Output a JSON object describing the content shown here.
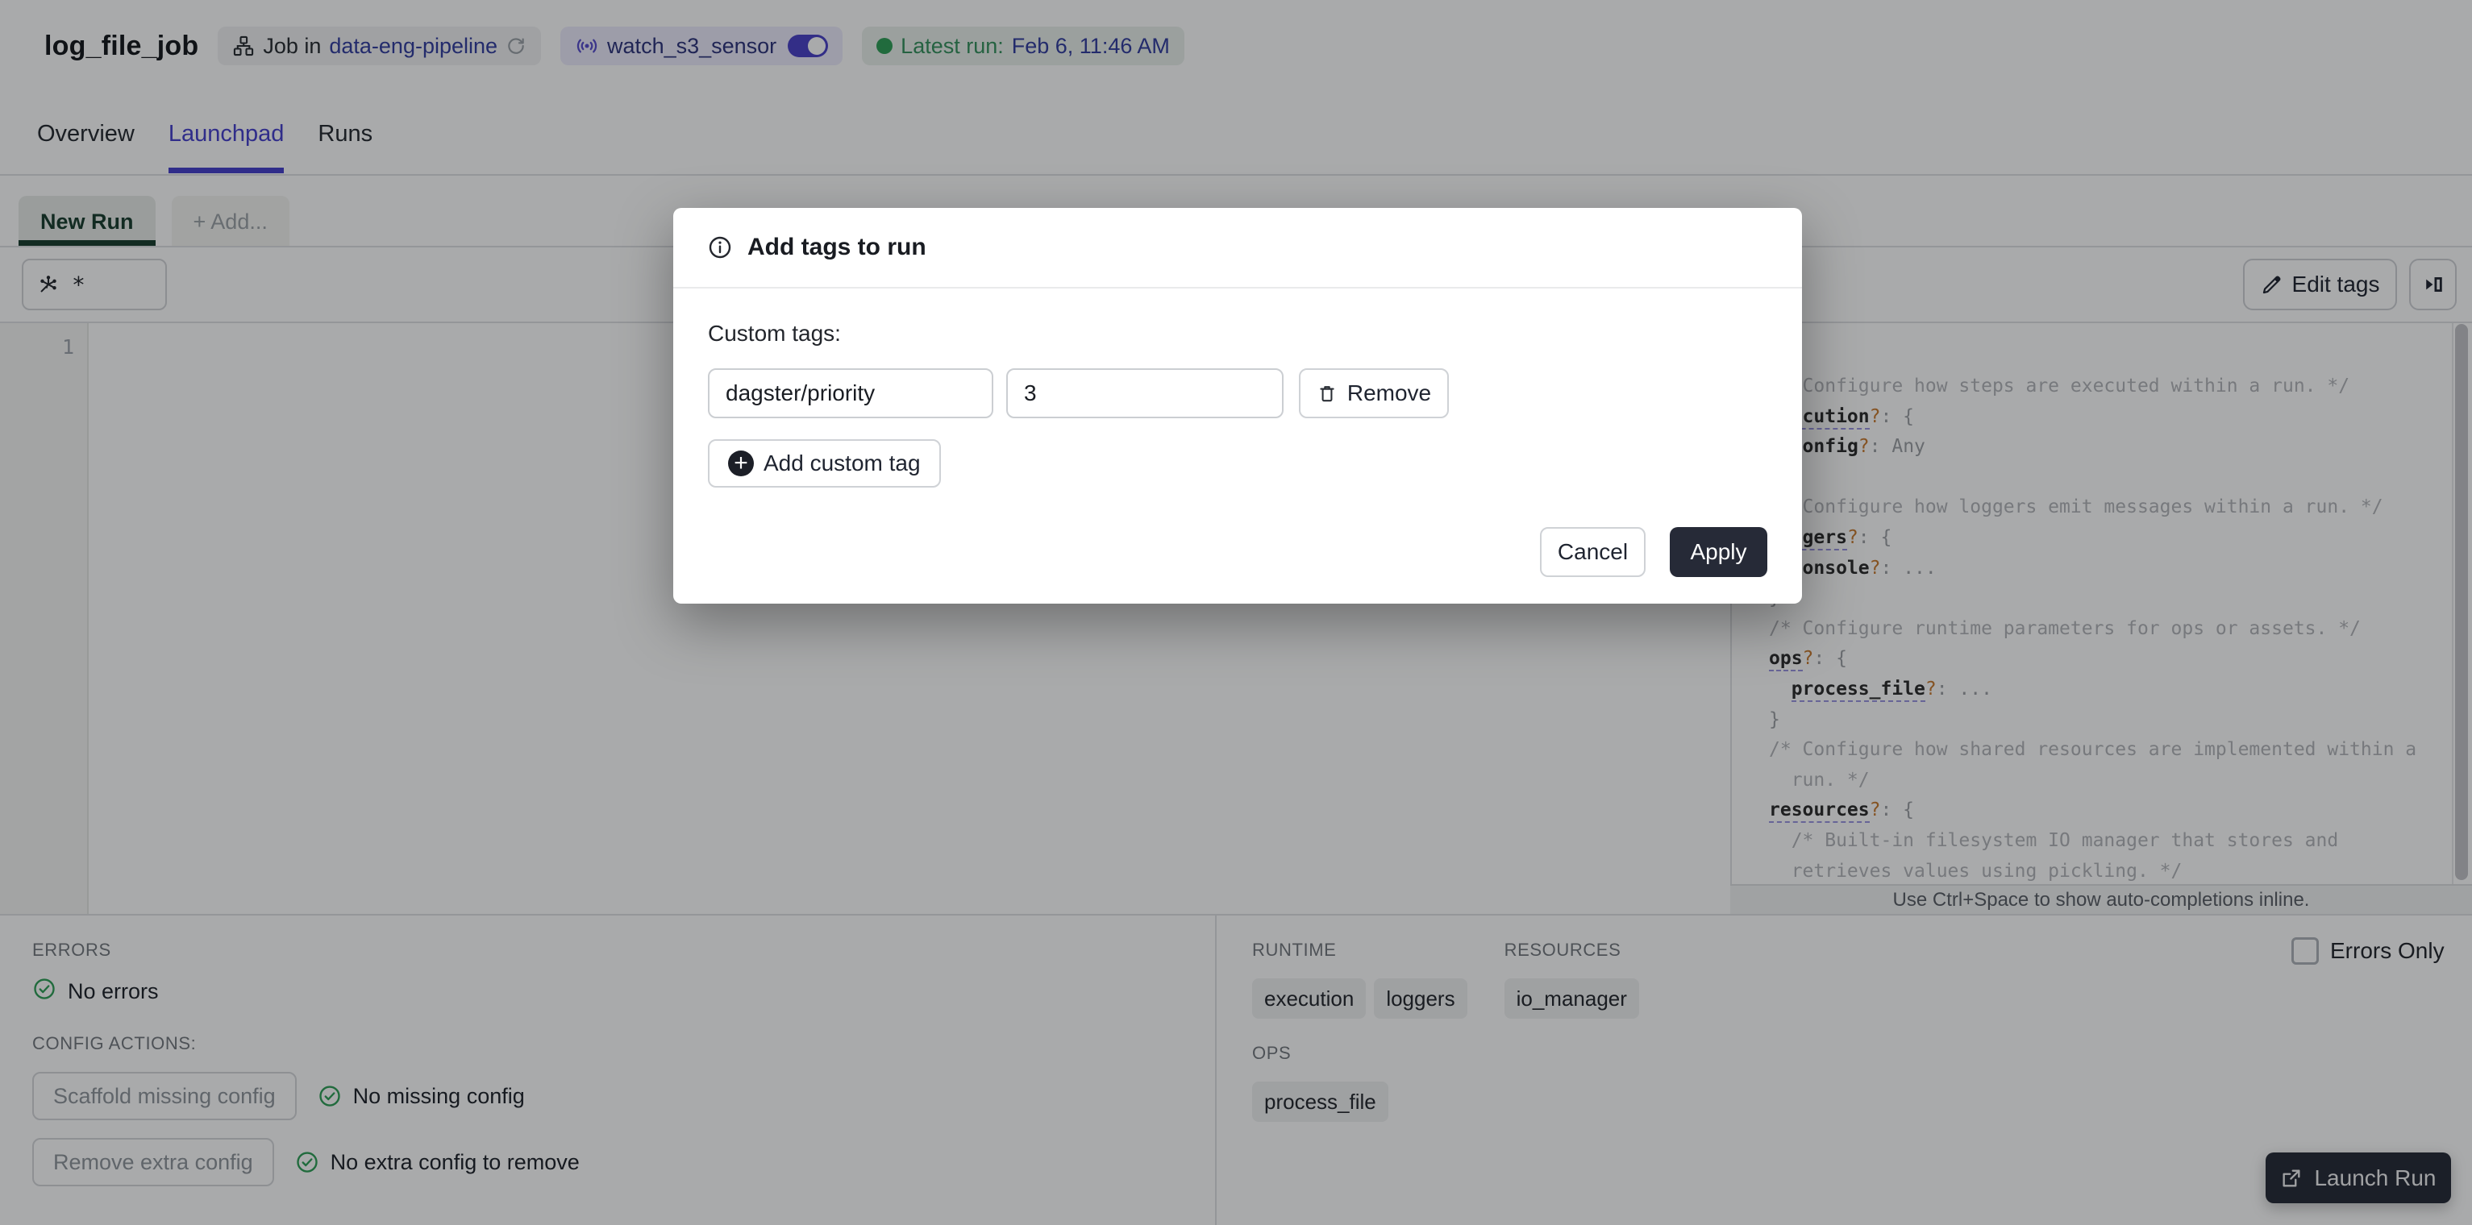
{
  "colors": {
    "accent_blurple": "#453FCC",
    "link_navy": "#323D9E",
    "sensor_badge_bg": "#EDEBFC",
    "latest_badge_bg": "#EAF0EC",
    "badge_bg": "#F1F2F3",
    "success_green": "#2E9E57",
    "primary_button_bg": "#262A37",
    "run_tab_green": "#183D2D",
    "code_key": "#2B2B2B",
    "code_comment": "#B2B4B8",
    "code_question": "#C87A2E",
    "code_punct": "#9B9EA3",
    "lint_underline": "#9A94E0"
  },
  "header": {
    "title": "log_file_job",
    "job_badge": {
      "prefix": "Job in",
      "link": "data-eng-pipeline"
    },
    "sensor_badge": {
      "label": "watch_s3_sensor",
      "toggle_on": true
    },
    "latest_run_badge": {
      "prefix": "Latest run:",
      "value": "Feb 6, 11:46 AM"
    }
  },
  "tabs": [
    {
      "label": "Overview",
      "active": false
    },
    {
      "label": "Launchpad",
      "active": true
    },
    {
      "label": "Runs",
      "active": false
    }
  ],
  "launchpad": {
    "run_tabs": [
      {
        "label": "New Run",
        "active": true
      },
      {
        "label": "+ Add...",
        "active": false
      }
    ],
    "op_selector": {
      "value": "*"
    },
    "toolbar": {
      "edit_tags_label": "Edit tags"
    },
    "editor": {
      "line_number": "1"
    },
    "hint_bar": "Use Ctrl+Space to show auto-completions inline."
  },
  "schema_panel": {
    "lines": [
      [
        [
          "cm",
          "/* Configure how steps are executed within a run. */"
        ]
      ],
      [
        [
          "ku",
          "execution"
        ],
        [
          "q",
          "?"
        ],
        [
          "p",
          ": {"
        ]
      ],
      [
        [
          "p",
          "  "
        ],
        [
          "k",
          "config"
        ],
        [
          "q",
          "?"
        ],
        [
          "p",
          ": "
        ],
        [
          "p",
          "Any"
        ]
      ],
      [
        [
          "p",
          "}"
        ]
      ],
      [
        [
          "cm",
          "/* Configure how loggers emit messages within a run. */"
        ]
      ],
      [
        [
          "ku",
          "loggers"
        ],
        [
          "q",
          "?"
        ],
        [
          "p",
          ": {"
        ]
      ],
      [
        [
          "p",
          "  "
        ],
        [
          "k",
          "console"
        ],
        [
          "q",
          "?"
        ],
        [
          "p",
          ": ..."
        ]
      ],
      [
        [
          "p",
          "}"
        ]
      ],
      [
        [
          "cm",
          "/* Configure runtime parameters for ops or assets. */"
        ]
      ],
      [
        [
          "ku",
          "ops"
        ],
        [
          "q",
          "?"
        ],
        [
          "p",
          ": {"
        ]
      ],
      [
        [
          "p",
          "  "
        ],
        [
          "ku",
          "process_file"
        ],
        [
          "q",
          "?"
        ],
        [
          "p",
          ": ..."
        ]
      ],
      [
        [
          "p",
          "}"
        ]
      ],
      [
        [
          "cm",
          "/* Configure how shared resources are implemented within a"
        ]
      ],
      [
        [
          "cm",
          "  run. */"
        ]
      ],
      [
        [
          "ku",
          "resources"
        ],
        [
          "q",
          "?"
        ],
        [
          "p",
          ": {"
        ]
      ],
      [
        [
          "cm",
          "  /* Built-in filesystem IO manager that stores and"
        ]
      ],
      [
        [
          "cm",
          "  retrieves values using pickling. */"
        ]
      ]
    ]
  },
  "modal": {
    "title": "Add tags to run",
    "custom_tags_label": "Custom tags:",
    "tag_key": "dagster/priority",
    "tag_value": "3",
    "remove_label": "Remove",
    "add_label": "Add custom tag",
    "cancel_label": "Cancel",
    "apply_label": "Apply"
  },
  "bottom_left": {
    "errors_label": "ERRORS",
    "no_errors": "No errors",
    "config_actions_label": "CONFIG ACTIONS:",
    "actions": [
      {
        "button": "Scaffold missing config",
        "status": "No missing config"
      },
      {
        "button": "Remove extra config",
        "status": "No extra config to remove"
      }
    ]
  },
  "bottom_right": {
    "rows": [
      [
        {
          "label": "RUNTIME",
          "tags": [
            "execution",
            "loggers"
          ]
        },
        {
          "label": "RESOURCES",
          "tags": [
            "io_manager"
          ]
        }
      ],
      [
        {
          "label": "OPS",
          "tags": [
            "process_file"
          ]
        }
      ]
    ],
    "errors_only_label": "Errors Only",
    "launch_label": "Launch Run"
  }
}
